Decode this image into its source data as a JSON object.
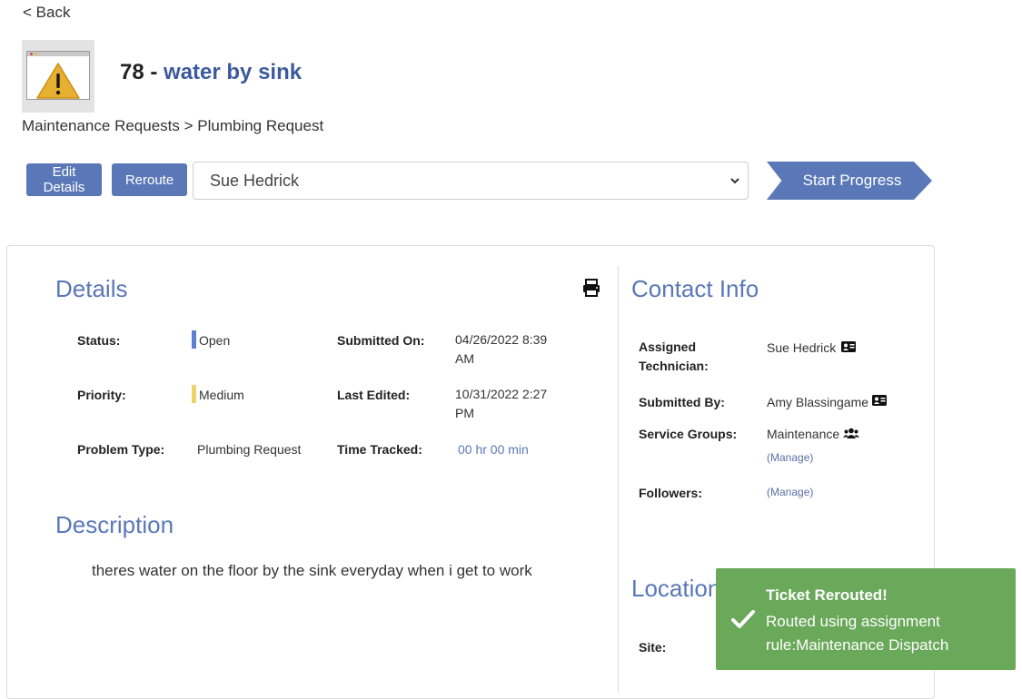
{
  "nav": {
    "back_label": "< Back"
  },
  "ticket": {
    "number": "78",
    "separator": " - ",
    "title": "water by sink",
    "thumbnail_icon": "warning-icon"
  },
  "breadcrumb": "Maintenance Requests > Plumbing Request",
  "actions": {
    "edit_label": "Edit Details",
    "reroute_label": "Reroute",
    "assignee_selected": "Sue Hedrick",
    "start_progress_label": "Start Progress"
  },
  "details": {
    "heading": "Details",
    "status_label": "Status:",
    "status_value": "Open",
    "status_color": "#5a7fd0",
    "priority_label": "Priority:",
    "priority_value": "Medium",
    "priority_color": "#f0d36a",
    "problem_type_label": "Problem Type:",
    "problem_type_value": "Plumbing Request",
    "submitted_on_label": "Submitted On:",
    "submitted_on_value": "04/26/2022 8:39 AM",
    "last_edited_label": "Last Edited:",
    "last_edited_value": "10/31/2022 2:27 PM",
    "time_tracked_label": "Time Tracked:",
    "time_tracked_value": "00 hr 00 min"
  },
  "description": {
    "heading": "Description",
    "text": "theres water on the floor by the sink everyday when i get to work"
  },
  "contact": {
    "heading": "Contact Info",
    "assigned_label": "Assigned Technician:",
    "assigned_value": "Sue Hedrick",
    "submitted_by_label": "Submitted By:",
    "submitted_by_value": "Amy Blassingame",
    "service_groups_label": "Service Groups:",
    "service_groups_value": "Maintenance",
    "service_groups_manage": "(Manage)",
    "followers_label": "Followers:",
    "followers_manage": "(Manage)"
  },
  "location": {
    "heading": "Location",
    "site_label": "Site:"
  },
  "toast": {
    "title": "Ticket Rerouted!",
    "message": "Routed using assignment rule:Maintenance Dispatch",
    "color": "#6aa85a"
  },
  "colors": {
    "accent": "#5a78b8",
    "title_link": "#3d5a9e"
  }
}
